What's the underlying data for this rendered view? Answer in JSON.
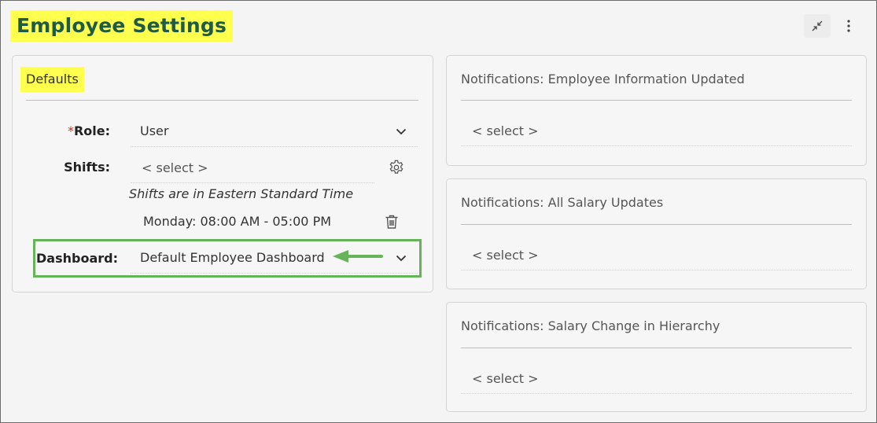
{
  "page": {
    "title": "Employee Settings"
  },
  "header": {
    "collapse_icon": "collapse-arrows-icon",
    "more_icon": "vertical-ellipsis-icon"
  },
  "defaults": {
    "title": "Defaults",
    "role": {
      "required_mark": "*",
      "label": "Role:",
      "value": "User"
    },
    "shifts": {
      "label": "Shifts:",
      "placeholder": "< select >",
      "timezone_note": "Shifts are in Eastern Standard Time",
      "entries": [
        {
          "text": "Monday: 08:00 AM - 05:00 PM"
        }
      ]
    },
    "dashboard": {
      "label": "Dashboard:",
      "value": "Default Employee Dashboard"
    }
  },
  "notifications": [
    {
      "title": "Notifications: Employee Information Updated",
      "placeholder": "< select >"
    },
    {
      "title": "Notifications: All Salary Updates",
      "placeholder": "< select >"
    },
    {
      "title": "Notifications: Salary Change in Hierarchy",
      "placeholder": "< select >"
    }
  ],
  "colors": {
    "highlight": "#ffff4d",
    "title_text": "#1f5a45",
    "callout_green": "#67b35a",
    "required": "#c0392b"
  }
}
